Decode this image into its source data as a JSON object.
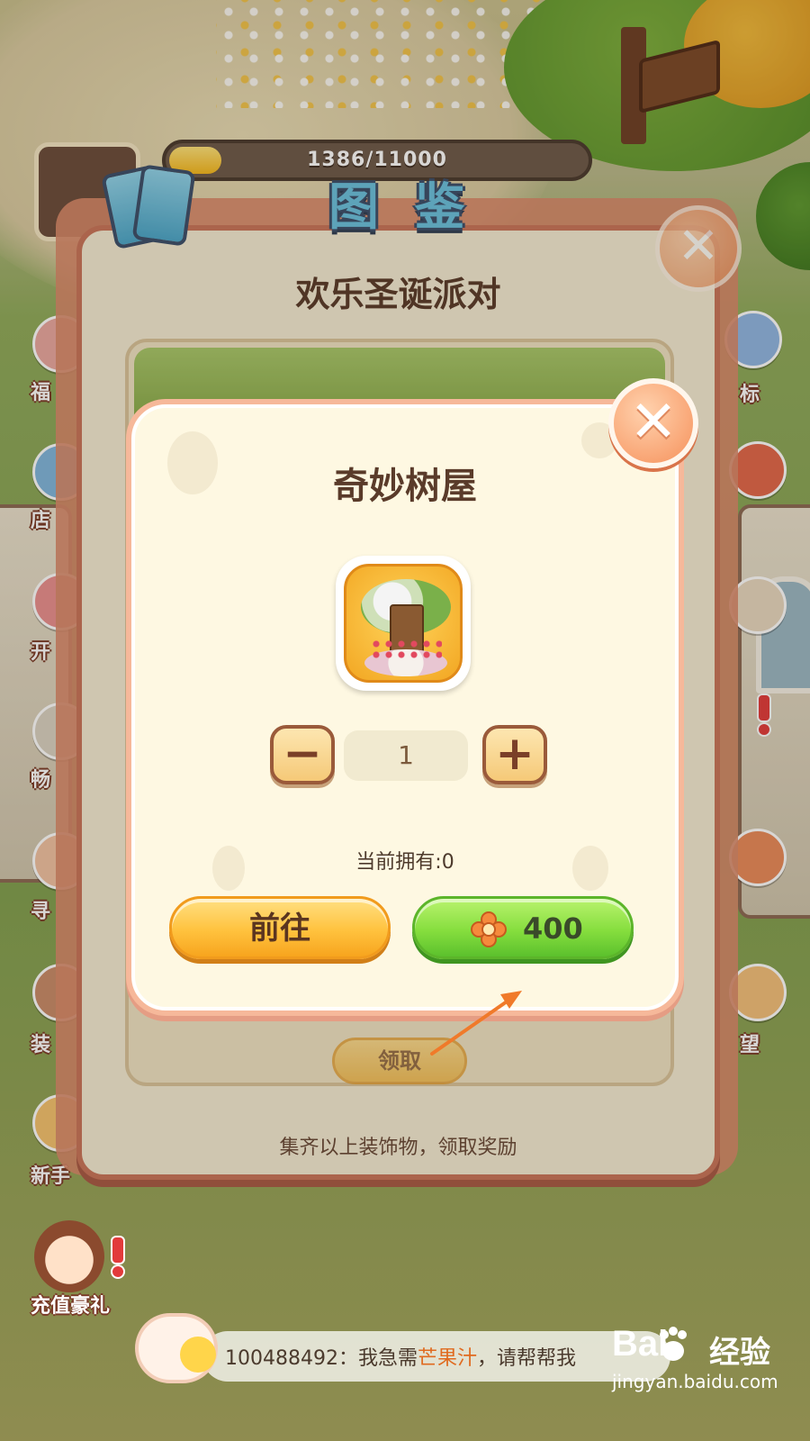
{
  "top_bar": {
    "progress_text": "1386/11000",
    "progress_fraction": 0.126,
    "title": "图 鉴"
  },
  "outer_panel": {
    "title": "欢乐圣诞派对",
    "claim_label": "领取",
    "footer": "集齐以上装饰物，领取奖励"
  },
  "side_menu": {
    "left_items": [
      "福",
      "店",
      "开",
      "畅",
      "寻",
      "装",
      "新手"
    ],
    "right_items": [
      "标",
      "",
      "",
      "",
      "",
      "望"
    ]
  },
  "dialog": {
    "title": "奇妙树屋",
    "item_icon": "treehouse-icon",
    "minus_symbol": "−",
    "plus_symbol": "+",
    "quantity": "1",
    "owned_text": "当前拥有:0",
    "goto_label": "前往",
    "price": "400",
    "price_currency_icon": "flower-coin-icon",
    "close_symbol": "✕"
  },
  "recharge": {
    "label": "充值豪礼"
  },
  "chat": {
    "user_id": "100488492",
    "prefix": "：我急需",
    "highlight": "芒果汁",
    "suffix": "，请帮帮我"
  },
  "watermark": {
    "logo": "Bai",
    "brand": "经验",
    "url": "jingyan.baidu.com"
  },
  "colors": {
    "buy_green": "#86de3e",
    "goto_orange": "#ffc23e",
    "panel_border": "#c9745a",
    "arrow": "#f07a2a"
  }
}
